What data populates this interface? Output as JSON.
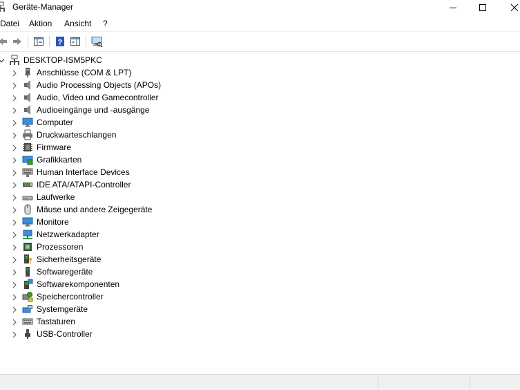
{
  "window": {
    "title": "Geräte-Manager"
  },
  "menu": [
    "Datei",
    "Aktion",
    "Ansicht",
    "?"
  ],
  "tree": {
    "root": "DESKTOP-ISM5PKC",
    "items": [
      {
        "label": "Anschlüsse (COM & LPT)",
        "icon": "port-icon"
      },
      {
        "label": "Audio Processing Objects (APOs)",
        "icon": "speaker-icon"
      },
      {
        "label": "Audio, Video und Gamecontroller",
        "icon": "speaker-icon"
      },
      {
        "label": "Audioeingänge und -ausgänge",
        "icon": "speaker-icon"
      },
      {
        "label": "Computer",
        "icon": "computer-icon"
      },
      {
        "label": "Druckwarteschlangen",
        "icon": "printer-icon"
      },
      {
        "label": "Firmware",
        "icon": "firmware-icon"
      },
      {
        "label": "Grafikkarten",
        "icon": "display-adapter-icon"
      },
      {
        "label": "Human Interface Devices",
        "icon": "hid-icon"
      },
      {
        "label": "IDE ATA/ATAPI-Controller",
        "icon": "ide-icon"
      },
      {
        "label": "Laufwerke",
        "icon": "disk-drive-icon"
      },
      {
        "label": "Mäuse und andere Zeigegeräte",
        "icon": "mouse-icon"
      },
      {
        "label": "Monitore",
        "icon": "monitor-icon"
      },
      {
        "label": "Netzwerkadapter",
        "icon": "network-icon"
      },
      {
        "label": "Prozessoren",
        "icon": "processor-icon"
      },
      {
        "label": "Sicherheitsgeräte",
        "icon": "security-icon"
      },
      {
        "label": "Softwaregeräte",
        "icon": "software-device-icon"
      },
      {
        "label": "Softwarekomponenten",
        "icon": "software-component-icon"
      },
      {
        "label": "Speichercontroller",
        "icon": "storage-icon"
      },
      {
        "label": "Systemgeräte",
        "icon": "system-icon"
      },
      {
        "label": "Tastaturen",
        "icon": "keyboard-icon"
      },
      {
        "label": "USB-Controller",
        "icon": "usb-icon"
      }
    ]
  },
  "colors": {
    "background": "#ffffff",
    "statusbar": "#f0f0f0",
    "accent": "#1e7fd6"
  }
}
